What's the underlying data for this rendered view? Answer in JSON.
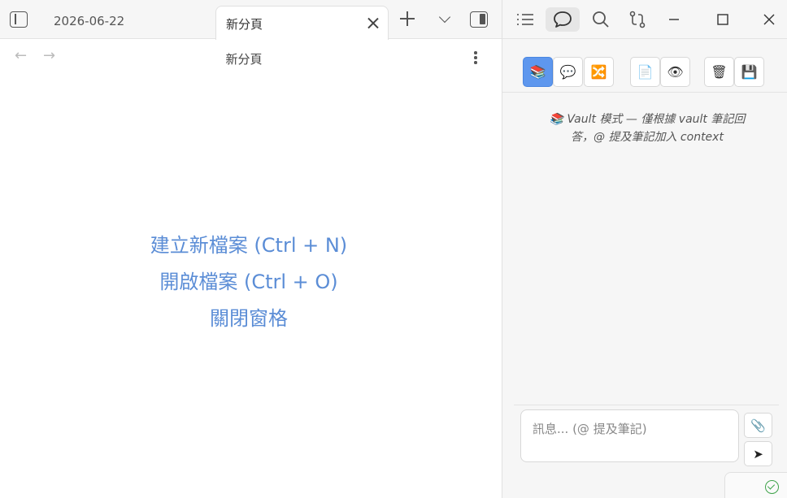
{
  "tabs": {
    "date_tab": "2026-06-22",
    "active_tab": "新分頁"
  },
  "nav": {
    "title": "新分頁",
    "back": "←",
    "forward": "→"
  },
  "empty_state": {
    "new_file": "建立新檔案 (Ctrl + N)",
    "open_file": "開啟檔案 (Ctrl + O)",
    "close_pane": "關閉窗格"
  },
  "chat": {
    "mode_buttons": [
      "📚",
      "💬",
      "🔀"
    ],
    "doc_buttons": [
      "📄",
      "👁"
    ],
    "action_buttons": [
      "🗑",
      "💾"
    ],
    "mode_info": "📚 Vault 模式 — 僅根據 vault 筆記回答，@ 提及筆記加入 context",
    "placeholder": "訊息... (@ 提及筆記)",
    "attach_icon": "📎",
    "send_icon": "➤"
  },
  "colors": {
    "link": "#5b8dd6",
    "active_mode": "#5e97ee",
    "status_ok": "#3ea34a"
  }
}
